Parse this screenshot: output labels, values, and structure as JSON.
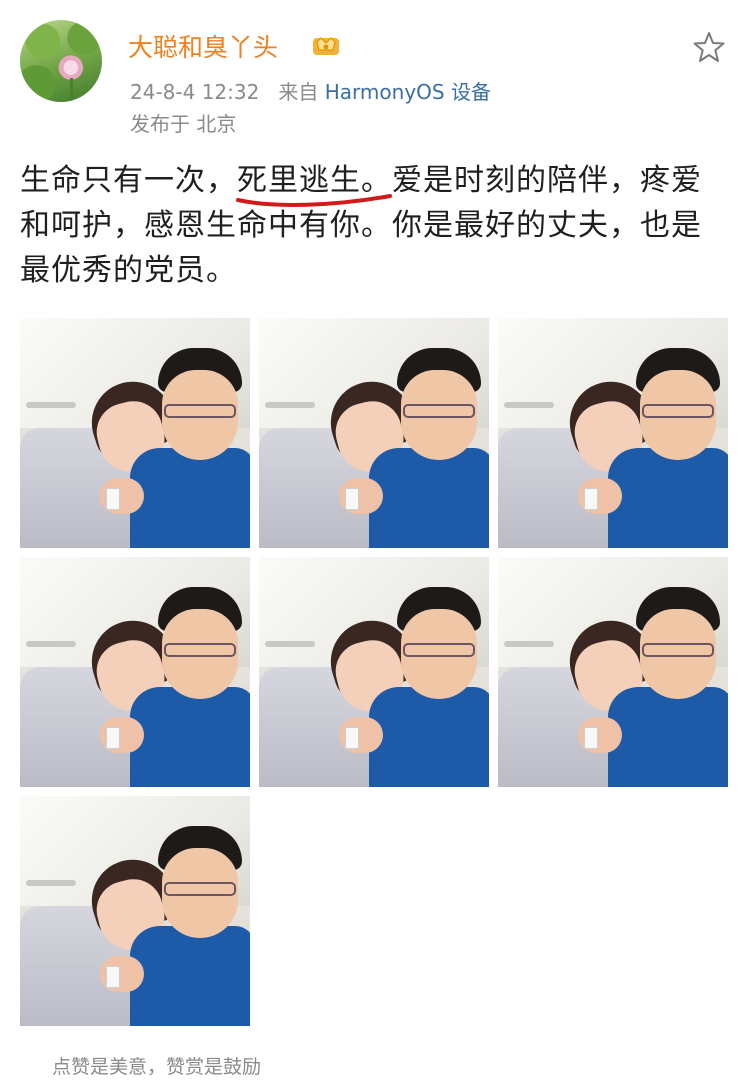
{
  "post": {
    "author": "大聪和臭丫头",
    "timestamp": "24-8-4 12:32",
    "source_prefix": "来自",
    "source_device": "HarmonyOS 设备",
    "location": "发布于 北京",
    "text": "生命只有一次，死里逃生。爱是时刻的陪伴，疼爱和呵护，感恩生命中有你。你是最好的丈夫，也是最优秀的党员。",
    "photos": [
      {
        "alt": ""
      },
      {
        "alt": ""
      },
      {
        "alt": ""
      },
      {
        "alt": ""
      },
      {
        "alt": ""
      },
      {
        "alt": ""
      },
      {
        "alt": ""
      }
    ],
    "footer_text": "点赞是美意，赞赏是鼓励"
  },
  "icons": {
    "avatar": "avatar-lotus",
    "vip": "vip-crown-icon",
    "star": "star-outline-icon"
  },
  "colors": {
    "username": "#f07f1e",
    "device_link": "#3a6ea5",
    "meta": "#8a8a8a",
    "underline_mark": "#d11b1b"
  }
}
